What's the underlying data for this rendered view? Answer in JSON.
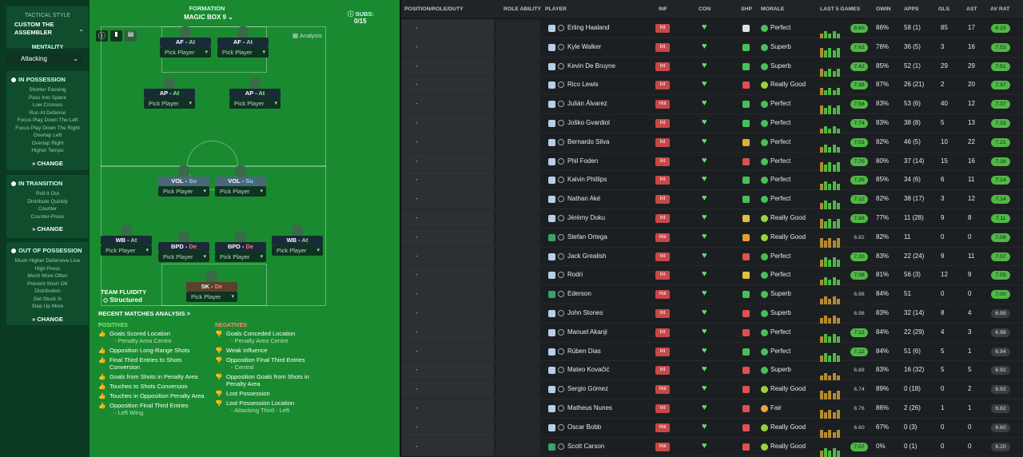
{
  "left_panel": {
    "tactical_style_label": "TACTICAL STYLE",
    "tactical_style_name": "CUSTOM THE ASSEMBLER",
    "mentality_label": "MENTALITY",
    "mentality_value": "Attacking",
    "in_possession": {
      "title": "IN POSSESSION",
      "items": [
        "Shorter Passing",
        "Pass Into Space",
        "Low Crosses",
        "Run At Defence",
        "Focus Play Down The Left",
        "Focus Play Down The Right",
        "Overlap Left",
        "Overlap Right",
        "Higher Tempo"
      ],
      "change": "CHANGE"
    },
    "in_transition": {
      "title": "IN TRANSITION",
      "items": [
        "Roll It Out",
        "Distribute Quickly",
        "Counter",
        "Counter-Press"
      ],
      "change": "CHANGE"
    },
    "out_of_possession": {
      "title": "OUT OF POSSESSION",
      "items": [
        "Much Higher Defensive Line",
        "High Press",
        "Much More Often",
        "Prevent Short GK",
        "Distribution",
        "Get Stuck In",
        "Step Up More"
      ],
      "change": "CHANGE"
    }
  },
  "pitch": {
    "formation_label": "FORMATION",
    "formation_name": "MAGIC BOX 9",
    "subs_label": "SUBS:",
    "subs_value": "0/15",
    "analysis_label": "Analysis",
    "pick_player": "Pick Player",
    "positions": [
      {
        "role": "AF",
        "duty": "At"
      },
      {
        "role": "AF",
        "duty": "At"
      },
      {
        "role": "AP",
        "duty": "At"
      },
      {
        "role": "AP",
        "duty": "At"
      },
      {
        "role": "VOL",
        "duty": "Su"
      },
      {
        "role": "VOL",
        "duty": "Su"
      },
      {
        "role": "WB",
        "duty": "At"
      },
      {
        "role": "BPD",
        "duty": "De"
      },
      {
        "role": "BPD",
        "duty": "De"
      },
      {
        "role": "WB",
        "duty": "At"
      },
      {
        "role": "SK",
        "duty": "De"
      }
    ],
    "team_fluidity_label": "TEAM FLUIDITY",
    "team_fluidity_value": "Structured",
    "recent_matches": "RECENT MATCHES ANALYSIS >",
    "positives_label": "POSITIVES",
    "negatives_label": "NEGATIVES",
    "positives": [
      {
        "t": "Goals Scored Location",
        "s": "- Penalty Area Centre"
      },
      {
        "t": "Opposition Long-Range Shots",
        "s": ""
      },
      {
        "t": "Final Third Entries to Shots Conversion",
        "s": ""
      },
      {
        "t": "Goals from Shots in Penalty Area",
        "s": ""
      },
      {
        "t": "Touches to Shots Conversion",
        "s": ""
      },
      {
        "t": "Touches in Opposition Penalty Area",
        "s": ""
      },
      {
        "t": "Opposition Final Third Entries",
        "s": "- Left Wing"
      }
    ],
    "negatives": [
      {
        "t": "Goals Conceded Location",
        "s": "- Penalty Area Centre"
      },
      {
        "t": "Weak Influence",
        "s": ""
      },
      {
        "t": "Opposition Final Third Entries",
        "s": "- Central"
      },
      {
        "t": "Opposition Goals from Shots in Penalty Area",
        "s": ""
      },
      {
        "t": "Lost Possession",
        "s": ""
      },
      {
        "t": "Lost Possession Location",
        "s": "- Attacking Third - Left"
      }
    ]
  },
  "table": {
    "headers": [
      "POSITION/ROLE/DUTY",
      "ROLE ABILITY",
      "PLAYER",
      "INF",
      "CON",
      "SHP",
      "MORALE",
      "LAST 5 GAMES",
      "GWIN",
      "APPS",
      "GLS",
      "AST",
      "AV RAT"
    ],
    "rows": [
      [
        "Erling Haaland",
        "Int",
        "Perfect",
        "8.60",
        "86%",
        "58 (1)",
        "85",
        "17",
        "8.15"
      ],
      [
        "Kyle Walker",
        "Int",
        "Superb",
        "7.62",
        "76%",
        "36 (5)",
        "3",
        "16",
        "7.53"
      ],
      [
        "Kevin De Bruyne",
        "Int",
        "Superb",
        "7.42",
        "85%",
        "52 (1)",
        "29",
        "29",
        "7.51"
      ],
      [
        "Rico Lewis",
        "Int",
        "Really Good",
        "7.38",
        "87%",
        "26 (21)",
        "2",
        "20",
        "7.37"
      ],
      [
        "Julián Álvarez",
        "Hol",
        "Perfect",
        "7.58",
        "83%",
        "53 (6)",
        "40",
        "12",
        "7.37"
      ],
      [
        "Joško Gvardiol",
        "Int",
        "Perfect",
        "7.74",
        "83%",
        "38 (8)",
        "5",
        "13",
        "7.33"
      ],
      [
        "Bernardo Silva",
        "Int",
        "Perfect",
        "7.03",
        "82%",
        "46 (5)",
        "10",
        "22",
        "7.21"
      ],
      [
        "Phil Foden",
        "Int",
        "Perfect",
        "7.70",
        "80%",
        "37 (14)",
        "15",
        "16",
        "7.16"
      ],
      [
        "Kalvin Phillips",
        "Int",
        "Perfect",
        "7.26",
        "85%",
        "34 (6)",
        "6",
        "11",
        "7.14"
      ],
      [
        "Nathan Aké",
        "Int",
        "Perfect",
        "7.12",
        "82%",
        "38 (17)",
        "3",
        "12",
        "7.14"
      ],
      [
        "Jérémy Doku",
        "Int",
        "Really Good",
        "7.68",
        "77%",
        "11 (28)",
        "9",
        "8",
        "7.11"
      ],
      [
        "Stefan Ortega",
        "Hol",
        "Really Good",
        "6.82",
        "82%",
        "11",
        "0",
        "0",
        "7.08"
      ],
      [
        "Jack Grealish",
        "Int",
        "Perfect",
        "7.20",
        "83%",
        "22 (24)",
        "9",
        "11",
        "7.07"
      ],
      [
        "Rodri",
        "Int",
        "Perfect",
        "7.08",
        "81%",
        "56 (3)",
        "12",
        "9",
        "7.05"
      ],
      [
        "Ederson",
        "Hol",
        "Superb",
        "6.98",
        "84%",
        "51",
        "0",
        "0",
        "7.00"
      ],
      [
        "John Stones",
        "Int",
        "Superb",
        "6.98",
        "83%",
        "32 (14)",
        "8",
        "4",
        "6.99"
      ],
      [
        "Manuel Akanji",
        "Int",
        "Perfect",
        "7.12",
        "84%",
        "22 (29)",
        "4",
        "3",
        "6.98"
      ],
      [
        "Rúben Dias",
        "Int",
        "Perfect",
        "7.12",
        "84%",
        "51 (6)",
        "5",
        "1",
        "6.94"
      ],
      [
        "Mateo Kovačić",
        "Int",
        "Superb",
        "6.88",
        "83%",
        "16 (32)",
        "5",
        "5",
        "6.92"
      ],
      [
        "Sergio Gómez",
        "Hol",
        "Really Good",
        "6.74",
        "89%",
        "0 (18)",
        "0",
        "2",
        "6.92"
      ],
      [
        "Matheus Nunes",
        "Int",
        "Fair",
        "6.76",
        "86%",
        "2 (26)",
        "1",
        "1",
        "6.82"
      ],
      [
        "Oscar Bobb",
        "Hol",
        "Really Good",
        "6.60",
        "67%",
        "0 (3)",
        "0",
        "0",
        "6.60"
      ],
      [
        "Scott Carson",
        "Hol",
        "Really Good",
        "7.07",
        "0%",
        "0 (1)",
        "0",
        "0",
        "6.20"
      ]
    ],
    "dash": "-"
  },
  "colors": {
    "pitch": "#1a8a30",
    "sidebar": "#0b3a23",
    "rating_green": "#50b844",
    "inf_red": "#c84747"
  }
}
